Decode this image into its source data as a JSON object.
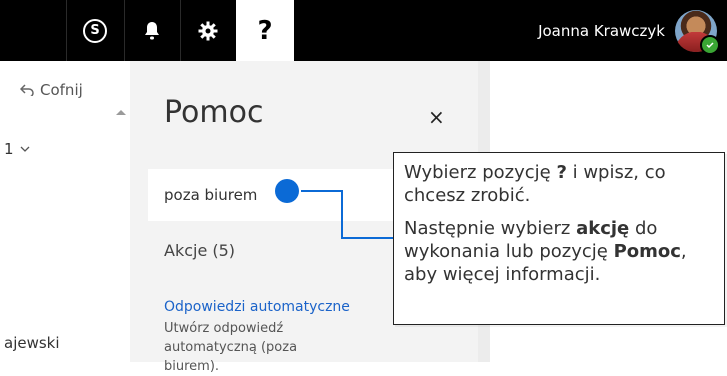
{
  "topbar": {
    "skype_icon_glyph": "S",
    "help_label": "?",
    "user_name": "Joanna Krawczyk"
  },
  "leftpanel": {
    "undo_label": "Cofnij",
    "count_label": "1",
    "name_fragment": "ajewski"
  },
  "help": {
    "title": "Pomoc",
    "close_label": "×",
    "search_value": "poza biurem",
    "actions_label": "Akcje (5)",
    "link_label": "Odpowiedzi automatyczne",
    "link_description": "Utwórz odpowiedź automatyczną (poza biurem)."
  },
  "callout": {
    "line1_prefix": "Wybierz pozycję ",
    "line1_bold": "?",
    "line1_suffix": " i wpisz, co chcesz zrobić.",
    "line2_prefix": "Następnie wybierz ",
    "line2_bold1": "akcję",
    "line2_mid": " do wykonania lub pozycję ",
    "line2_bold2": "Pomoc",
    "line2_suffix": ", aby więcej informacji."
  },
  "colors": {
    "topbar": "#000000",
    "accent": "#1b63c9",
    "connector": "#0b6ad6",
    "presence": "#3aa534"
  }
}
